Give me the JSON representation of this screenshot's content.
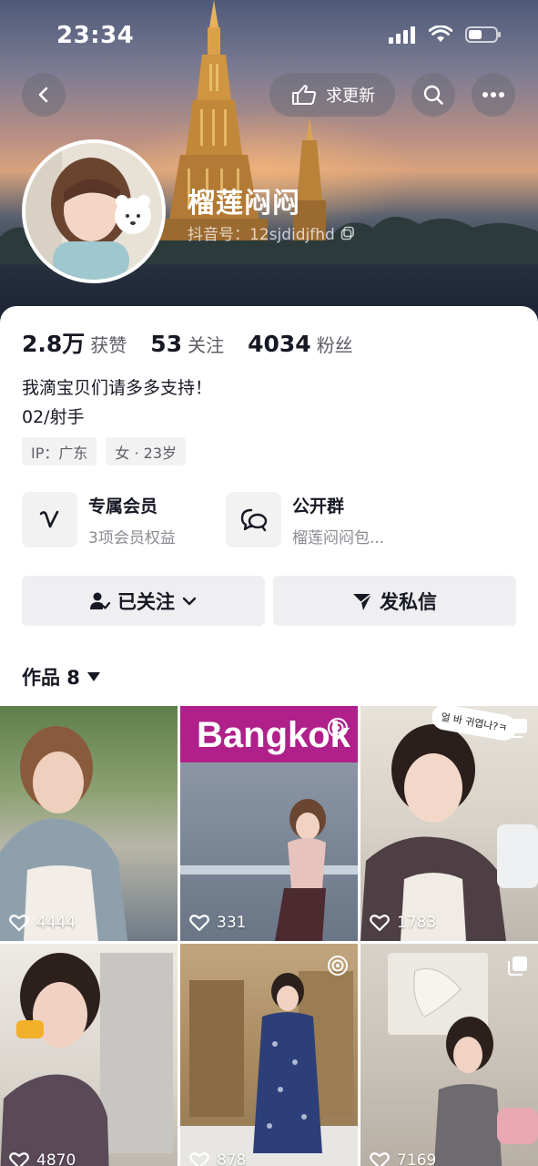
{
  "status_bar": {
    "time": "23:34"
  },
  "header": {
    "request_update_label": "求更新",
    "nickname": "榴莲闷闷",
    "douyin_id": "抖音号：12sjdidjfhd"
  },
  "stats": [
    {
      "value": "2.8万",
      "label": "获赞"
    },
    {
      "value": "53",
      "label": "关注"
    },
    {
      "value": "4034",
      "label": "粉丝"
    }
  ],
  "bio": {
    "line1": "我滴宝贝们请多多支持！",
    "line2": "02/射手"
  },
  "tags": [
    "IP：广东",
    "女 · 23岁"
  ],
  "features": [
    {
      "title": "专属会员",
      "subtitle": "3项会员权益",
      "icon": "vip-v-icon"
    },
    {
      "title": "公开群",
      "subtitle": "榴莲闷闷包...",
      "icon": "group-chat-icon"
    }
  ],
  "actions": {
    "follow_label": "已关注",
    "message_label": "发私信"
  },
  "works": {
    "label": "作品 8"
  },
  "grid": [
    {
      "likes": "4444",
      "badge": ""
    },
    {
      "likes": "331",
      "badge": "live-icon",
      "sign_text": "Bangkok"
    },
    {
      "likes": "1783",
      "badge": "multi-image-icon",
      "sticker_text": "얼 바 귀엽나?ㅋ"
    },
    {
      "likes": "4870",
      "badge": ""
    },
    {
      "likes": "878",
      "badge": "live-icon"
    },
    {
      "likes": "7169",
      "badge": "multi-image-icon"
    }
  ]
}
